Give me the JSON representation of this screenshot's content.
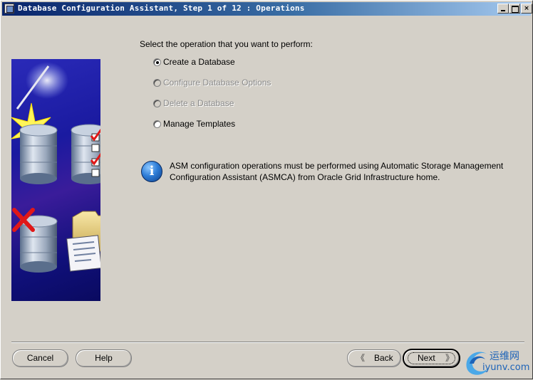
{
  "window": {
    "title": "Database Configuration Assistant, Step 1 of 12 : Operations",
    "controls": {
      "minimize": "",
      "maximize": "",
      "close": "×"
    }
  },
  "main": {
    "prompt": "Select the operation that you want to perform:",
    "options": [
      {
        "label": "Create a Database",
        "selected": true,
        "enabled": true
      },
      {
        "label": "Configure Database Options",
        "selected": false,
        "enabled": false
      },
      {
        "label": "Delete a Database",
        "selected": false,
        "enabled": false
      },
      {
        "label": "Manage Templates",
        "selected": false,
        "enabled": true
      }
    ],
    "info": {
      "icon": "info-icon",
      "glyph": "i",
      "text": "ASM configuration operations must be performed using Automatic Storage Management Configuration Assistant (ASMCA) from Oracle Grid Infrastructure home."
    }
  },
  "footer": {
    "cancel_label": "Cancel",
    "help_label": "Help",
    "back_label": "Back",
    "next_label": "Next",
    "back_chevron": "《",
    "next_chevron": "》"
  },
  "watermark": {
    "text_cn": "运维网",
    "text_en": "iyunv.com"
  },
  "colors": {
    "window_bg": "#d4d0c8",
    "titlebar_start": "#08246b",
    "titlebar_end": "#a6caf0",
    "banner_bg": "#1a1aa0",
    "disabled_text": "#8a8a8a",
    "watermark": "#1d63b8"
  }
}
